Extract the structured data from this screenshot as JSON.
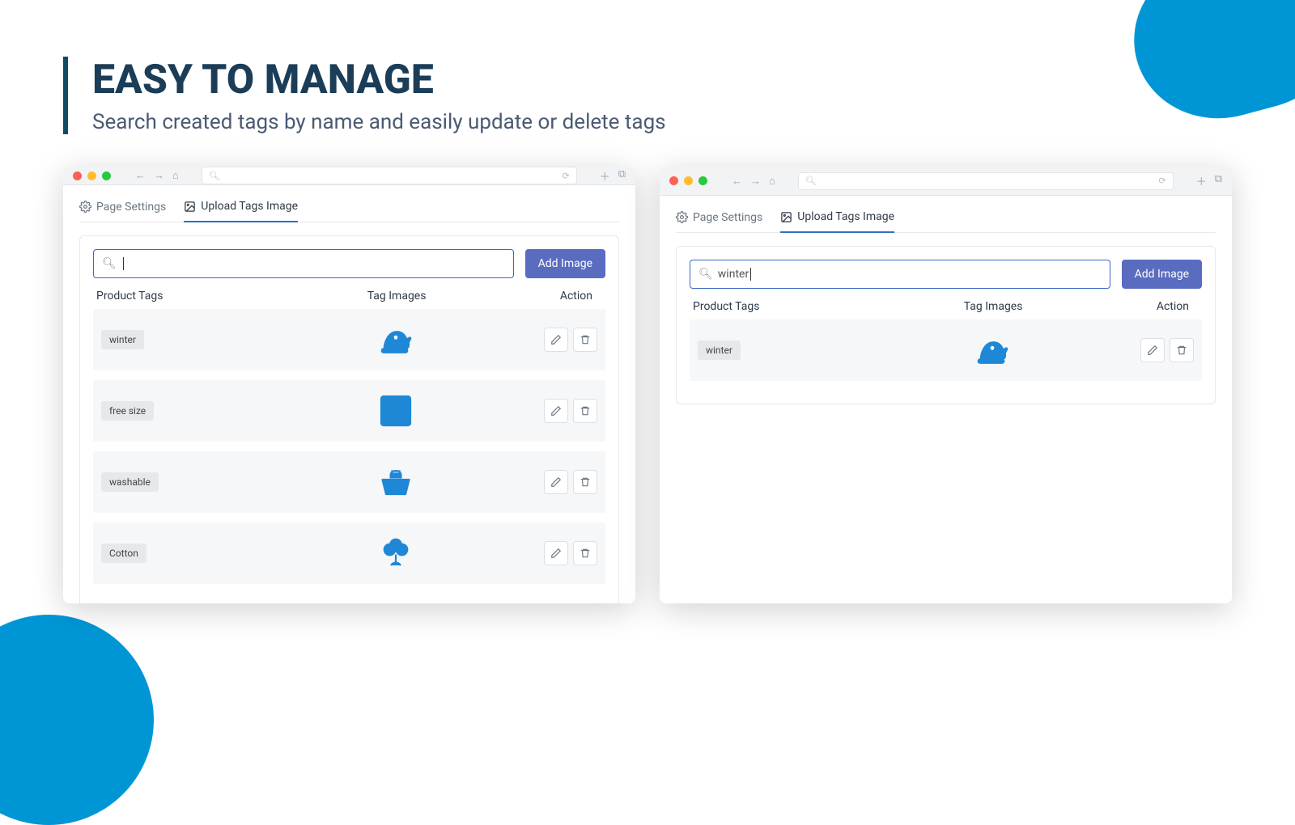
{
  "heading": "EASY TO MANAGE",
  "subheading": "Search created tags by name and easily update or delete tags",
  "tabs": {
    "settings": "Page Settings",
    "upload": "Upload Tags Image"
  },
  "add_button": "Add Image",
  "columns": {
    "tags": "Product Tags",
    "images": "Tag Images",
    "action": "Action"
  },
  "panel_left": {
    "search_value": "",
    "rows": [
      {
        "tag": "winter",
        "icon": "santa-hat"
      },
      {
        "tag": "free size",
        "icon": "measure"
      },
      {
        "tag": "washable",
        "icon": "wash"
      },
      {
        "tag": "Cotton",
        "icon": "cotton"
      }
    ]
  },
  "panel_right": {
    "search_value": "winter",
    "rows": [
      {
        "tag": "winter",
        "icon": "santa-hat"
      }
    ]
  }
}
